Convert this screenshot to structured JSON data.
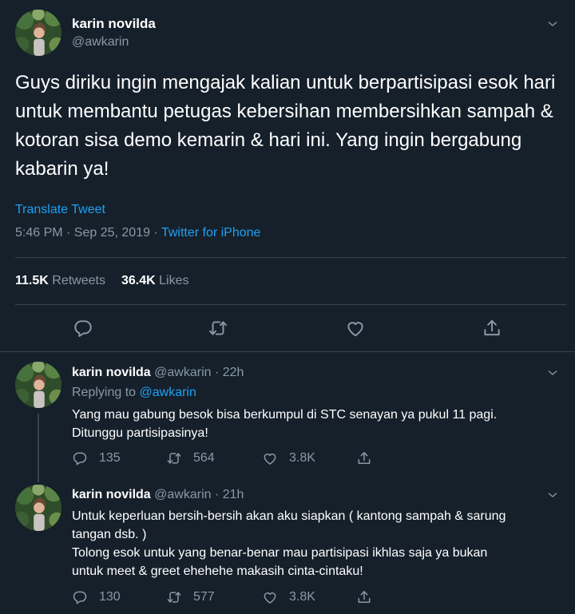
{
  "main_tweet": {
    "name": "karin novilda",
    "handle": "@awkarin",
    "text": "Guys diriku ingin mengajak kalian untuk berpartisipasi esok hari untuk membantu petugas kebersihan membersihkan sampah & kotoran sisa demo kemarin & hari ini. Yang ingin bergabung kabarin ya!",
    "translate_label": "Translate Tweet",
    "time": "5:46 PM · Sep 25, 2019 · ",
    "source": "Twitter for iPhone",
    "retweets_count": "11.5K",
    "retweets_label": "Retweets",
    "likes_count": "36.4K",
    "likes_label": "Likes"
  },
  "replies": [
    {
      "name": "karin novilda",
      "meta": "@awkarin · 22h",
      "replying_prefix": "Replying to ",
      "replying_to": "@awkarin",
      "text_lines": [
        "Yang mau gabung besok bisa berkumpul di STC senayan ya pukul 11 pagi.",
        "Ditunggu partisipasinya!"
      ],
      "replies": "135",
      "retweets": "564",
      "likes": "3.8K"
    },
    {
      "name": "karin novilda",
      "meta": "@awkarin · 21h",
      "text_lines": [
        "Untuk keperluan bersih-bersih akan aku siapkan ( kantong sampah & sarung",
        "tangan dsb. )",
        "Tolong esok untuk yang benar-benar mau partisipasi ikhlas saja ya bukan",
        "untuk meet & greet ehehehe makasih cinta-cintaku!"
      ],
      "replies": "130",
      "retweets": "577",
      "likes": "3.8K"
    }
  ],
  "icons": {
    "reply": "reply-icon",
    "retweet": "retweet-icon",
    "like": "heart-icon",
    "share": "share-icon",
    "more": "chevron-down-icon"
  },
  "colors": {
    "background": "#15202b",
    "accent": "#1da1f2",
    "muted": "#8899a6",
    "divider": "#38444d"
  }
}
